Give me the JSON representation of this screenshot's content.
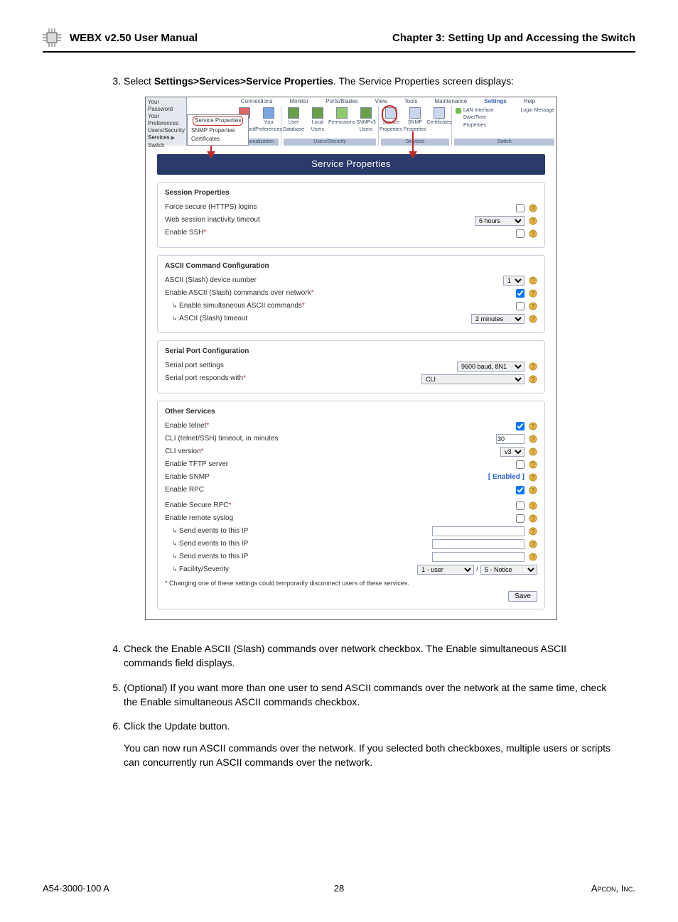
{
  "header": {
    "product": "WebX v2.50 User Manual",
    "product_prefix": "W",
    "product_rest": "EB",
    "chapter": "Chapter 3: Setting Up and Accessing the Switch"
  },
  "steps": {
    "s3_pre": "Select ",
    "s3_bold": "Settings>Services>Service Properties",
    "s3_post": ". The Service Properties screen displays:",
    "s4": "Check the Enable ASCII (Slash) commands over network checkbox. The Enable simultaneous ASCII commands field displays.",
    "s5": "(Optional) If you want more than one user to send ASCII commands over the network at the same time, check the Enable simultaneous ASCII commands checkbox.",
    "s6": "Click the Update button.",
    "after6": "You can now run ASCII commands over the network. If you selected both checkboxes, multiple users or scripts can concurrently run ASCII commands over the network."
  },
  "leftnav": {
    "i1": "Your Password",
    "i2": "Your Preferences",
    "i3": "Users/Security",
    "i4": "Services",
    "i5": "Switch"
  },
  "submenu": {
    "i1": "Service Properties",
    "i2": "SNMP Properties",
    "i3": "Certificates"
  },
  "topmenu": {
    "t1": "Connections",
    "t2": "Monitor",
    "t3": "Ports/Blades",
    "t4": "View",
    "t5": "Tools",
    "t6": "Maintenance",
    "t7": "Settings",
    "t8": "Help"
  },
  "toolbar": {
    "g1": "Personalization",
    "g1a": "Your Password",
    "g1b": "Your Preferences",
    "g2": "Users/Security",
    "g2a": "User Database",
    "g2b": "Local Users",
    "g2c": "Permissions",
    "g2d": "SNMPv3 Users",
    "g3": "Services",
    "g3a": "Service Properties",
    "g3b": "SNMP Properties",
    "g3c": "Certificates",
    "g4": "Switch",
    "g4a": "LAN Interface",
    "g4b": "Login Message",
    "g4c": "Date/Time",
    "g4d": "Properties"
  },
  "panel": {
    "title": "Service Properties"
  },
  "session": {
    "heading": "Session Properties",
    "r1": "Force secure (HTTPS) logins",
    "r2": "Web session inactivity timeout",
    "r2v": "6 hours",
    "r3": "Enable SSH"
  },
  "ascii": {
    "heading": "ASCII Command Configuration",
    "r1": "ASCII (Slash) device number",
    "r1v": "1",
    "r2": "Enable ASCII (Slash) commands over network",
    "r3": "Enable simultaneous ASCII commands",
    "r4": "ASCII (Slash) timeout",
    "r4v": "2 minutes"
  },
  "serial": {
    "heading": "Serial Port Configuration",
    "r1": "Serial port settings",
    "r1v": "9600 baud, 8N1",
    "r2": "Serial port responds with",
    "r2v": "CLI"
  },
  "other": {
    "heading": "Other Services",
    "r1": "Enable telnet",
    "r2": "CLI (telnet/SSH) timeout, in minutes",
    "r2v": "30",
    "r3": "CLI version",
    "r3v": "v3",
    "r4": "Enable TFTP server",
    "r5": "Enable SNMP",
    "r5v": "[ Enabled ]",
    "r6": "Enable RPC",
    "r7": "Enable Secure RPC",
    "r8": "Enable remote syslog",
    "r9": "Send events to this IP",
    "r10": "Send events to this IP",
    "r11": "Send events to this IP",
    "r12": "Facility/Severity",
    "r12a": "1 - user",
    "r12b": "5 - Notice",
    "slash": "/"
  },
  "footnote": {
    "star": "*",
    "text": " Changing one of these settings could temporarily disconnect users of these services."
  },
  "save": "Save",
  "footer": {
    "left": "A54-3000-100 A",
    "center": "28",
    "right_sc": "Apcon",
    "right_after": ", Inc."
  }
}
